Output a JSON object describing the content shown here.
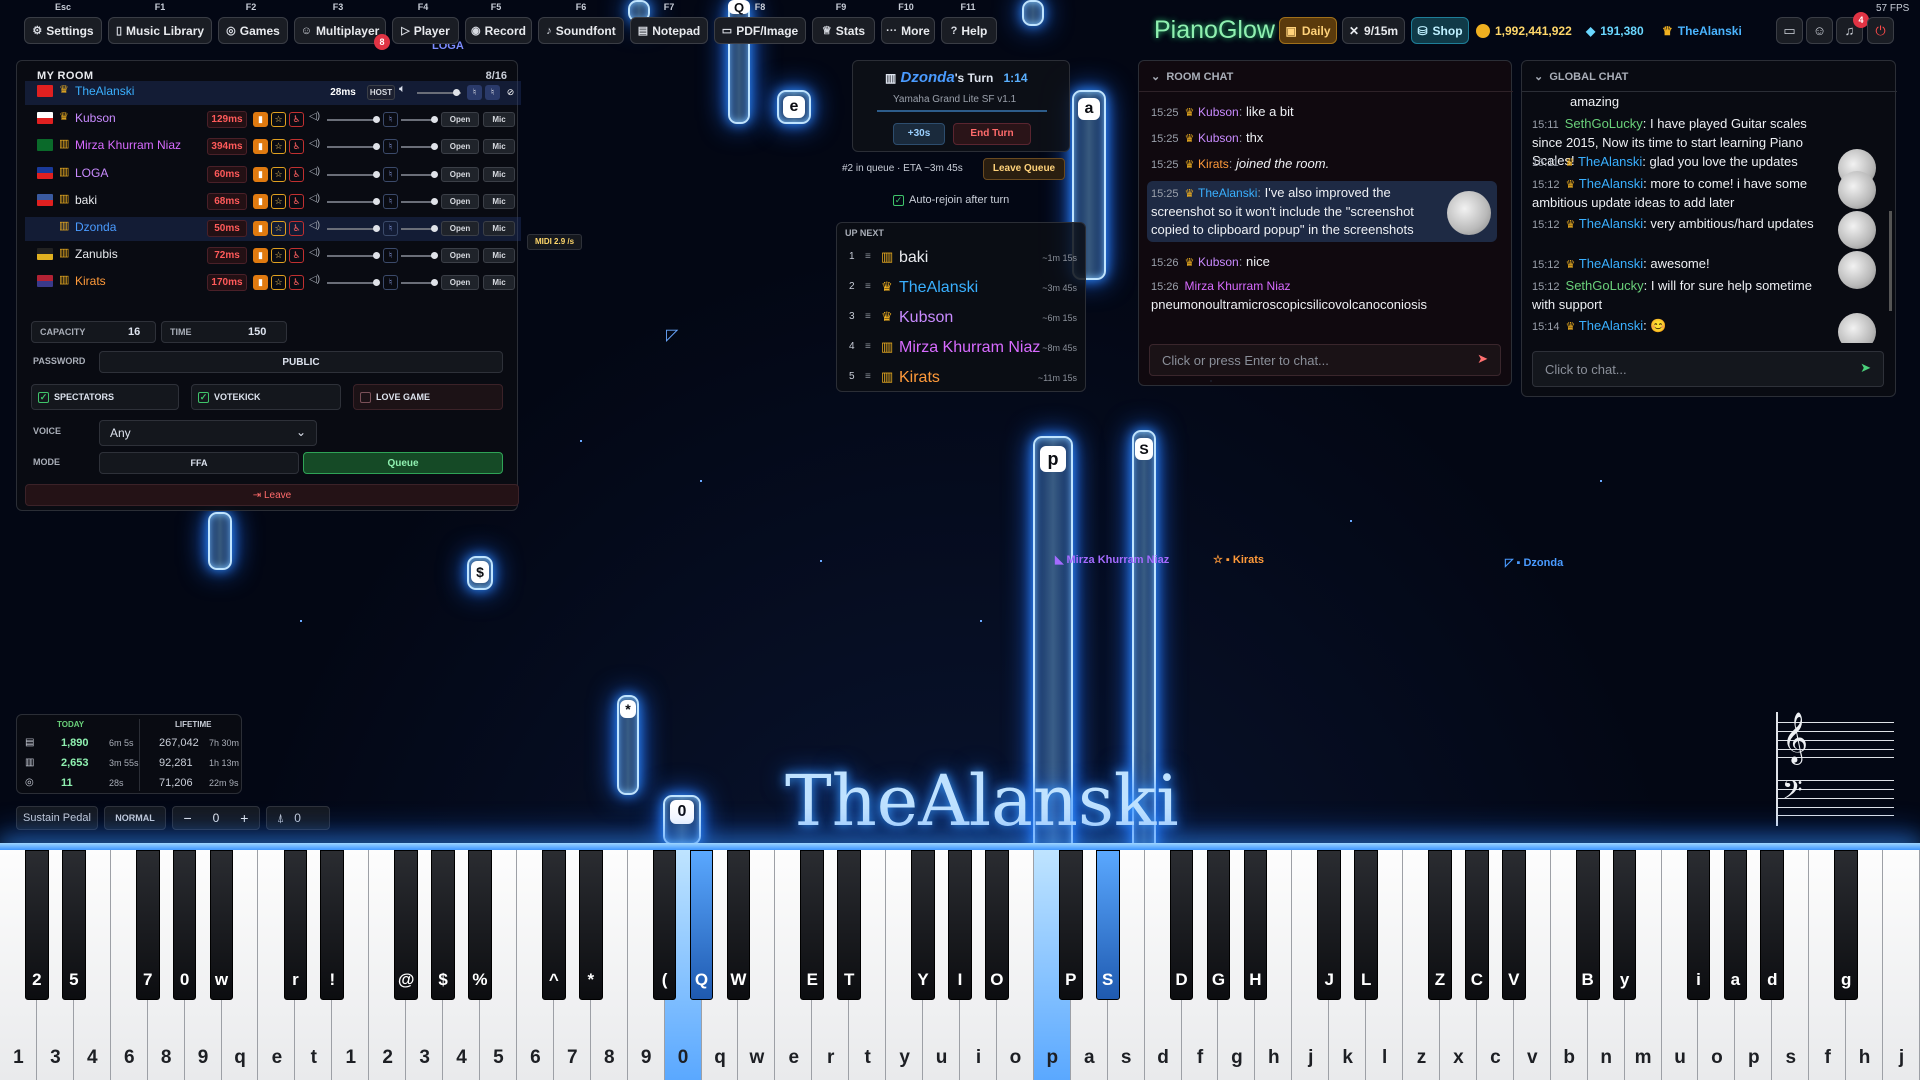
{
  "topbar": {
    "fkeys": [
      "Esc",
      "F1",
      "F2",
      "F3",
      "F4",
      "F5",
      "F6",
      "F7",
      "F8",
      "F9",
      "F10",
      "F11"
    ],
    "buttons": [
      "Settings",
      "Music Library",
      "Games",
      "Multiplayer",
      "Player",
      "Record",
      "Soundfont",
      "Notepad",
      "PDF/Image",
      "Stats",
      "More",
      "Help"
    ],
    "multiplayer_badge": "8",
    "brand": "PianoGlow",
    "daily": "Daily",
    "rate": "9/15m",
    "shop": "Shop",
    "coins": "1,992,441,922",
    "gems": "191,380",
    "username": "TheAlanski",
    "notif_count": "4",
    "fps": "57 FPS"
  },
  "room": {
    "title": "MY ROOM",
    "count": "8/16",
    "players": [
      {
        "name": "TheAlanski",
        "ping": "28ms",
        "host": "HOST",
        "crown": true,
        "color": "#3ab0ff"
      },
      {
        "name": "Kubson",
        "ping": "129ms",
        "crown": true,
        "color": "#c98bff"
      },
      {
        "name": "Mirza Khurram Niaz",
        "ping": "394ms",
        "crown": false,
        "color": "#d86bff"
      },
      {
        "name": "LOGA",
        "ping": "60ms",
        "crown": false,
        "color": "#c98bff"
      },
      {
        "name": "baki",
        "ping": "68ms",
        "crown": false,
        "color": "#e8eaee"
      },
      {
        "name": "Dzonda",
        "ping": "50ms",
        "crown": false,
        "color": "#4a9bff"
      },
      {
        "name": "Zanubis",
        "ping": "72ms",
        "crown": false,
        "color": "#e8eaee"
      },
      {
        "name": "Kirats",
        "ping": "170ms",
        "crown": false,
        "color": "#ff9a3a"
      }
    ],
    "open": "Open",
    "mic": "Mic",
    "capacity_label": "CAPACITY",
    "capacity": "16",
    "time_label": "TIME",
    "time": "150",
    "password_label": "PASSWORD",
    "password": "PUBLIC",
    "spectators": "SPECTATORS",
    "votekick": "VOTEKICK",
    "love": "LOVE GAME",
    "voice_label": "VOICE",
    "voice": "Any",
    "mode_label": "MODE",
    "mode_ffa": "FFA",
    "mode_queue": "Queue",
    "leave": "Leave",
    "midi": "MIDI 2.9 /s"
  },
  "turn": {
    "player": "Dzonda",
    "suffix": "'s Turn",
    "timer": "1:14",
    "instrument": "Yamaha Grand Lite SF v1.1",
    "plus": "+30s",
    "end": "End Turn",
    "queue_info": "#2 in queue · ETA ~3m 45s",
    "leave_queue": "Leave Queue",
    "autorejoin": "Auto-rejoin after turn",
    "upnext": "UP NEXT",
    "queue": [
      {
        "n": "1",
        "name": "baki",
        "eta": "~1m 15s",
        "color": "#e8eaee"
      },
      {
        "n": "2",
        "name": "TheAlanski",
        "eta": "~3m 45s",
        "color": "#3ab0ff"
      },
      {
        "n": "3",
        "name": "Kubson",
        "eta": "~6m 15s",
        "color": "#c98bff"
      },
      {
        "n": "4",
        "name": "Mirza Khurram Niaz",
        "eta": "~8m 45s",
        "color": "#d86bff"
      },
      {
        "n": "5",
        "name": "Kirats",
        "eta": "~11m 15s",
        "color": "#ff9a3a"
      }
    ]
  },
  "roomchat": {
    "title": "ROOM CHAT",
    "messages": [
      {
        "t": "15:25",
        "user": "Kubson",
        "text": "like a bit"
      },
      {
        "t": "15:25",
        "user": "Kubson",
        "text": "thx"
      },
      {
        "t": "15:25",
        "user": "Kirats",
        "text": "joined the room."
      },
      {
        "t": "15:25",
        "user": "TheAlanski",
        "text": "I've also improved the screenshot so it won't include the \"screenshot copied to clipboard popup\" in the screenshots"
      },
      {
        "t": "15:26",
        "user": "Kubson",
        "text": "nice"
      },
      {
        "t": "15:26",
        "user": "Mirza Khurram Niaz",
        "text": "pneumonoultramicroscopicsilicovolcanoconiosis"
      }
    ],
    "placeholder": "Click or press Enter to chat..."
  },
  "globalchat": {
    "title": "GLOBAL CHAT",
    "messages": [
      {
        "t": "",
        "user": "",
        "text": "amazing"
      },
      {
        "t": "15:11",
        "user": "SethGoLucky",
        "text": "I have played Guitar scales since 2015, Now its time to start learning Piano Scales!"
      },
      {
        "t": "15:11",
        "user": "TheAlanski",
        "text": "glad you love the updates"
      },
      {
        "t": "15:12",
        "user": "TheAlanski",
        "text": "more to come! i have some ambitious update ideas to add later"
      },
      {
        "t": "15:12",
        "user": "TheAlanski",
        "text": "very ambitious/hard updates"
      },
      {
        "t": "15:12",
        "user": "TheAlanski",
        "text": "awesome!"
      },
      {
        "t": "15:12",
        "user": "SethGoLucky",
        "text": "I will for sure help sometime with support"
      },
      {
        "t": "15:14",
        "user": "TheAlanski",
        "text": "😊"
      }
    ],
    "placeholder": "Click to chat..."
  },
  "stats": {
    "today": "TODAY",
    "lifetime": "LIFETIME",
    "rows": [
      {
        "a": "1,890",
        "b": "6m 5s",
        "c": "267,042",
        "d": "7h 30m"
      },
      {
        "a": "2,653",
        "b": "3m 55s",
        "c": "92,281",
        "d": "1h 13m"
      },
      {
        "a": "11",
        "b": "28s",
        "c": "71,206",
        "d": "22m 9s"
      }
    ]
  },
  "controls": {
    "sustain": "Sustain Pedal",
    "normal": "NORMAL",
    "minus": "−",
    "value": "0",
    "plus": "+",
    "metro": "0"
  },
  "stage": {
    "player_name": "TheAlanski",
    "cursors": [
      {
        "name": "LOGA"
      },
      {
        "name": "Mirza Khurram Niaz"
      },
      {
        "name": "Kirats"
      },
      {
        "name": "Dzonda"
      }
    ]
  },
  "notes": {
    "letters": [
      "Q",
      "e",
      "a",
      "$",
      "*",
      "0",
      "p",
      "S"
    ]
  },
  "piano": {
    "white_labels": [
      "1",
      "3",
      "4",
      "6",
      "8",
      "9",
      "q",
      "e",
      "t",
      "1",
      "2",
      "3",
      "4",
      "5",
      "6",
      "7",
      "8",
      "9",
      "0",
      "q",
      "w",
      "e",
      "r",
      "t",
      "y",
      "u",
      "i",
      "o",
      "p",
      "a",
      "s",
      "d",
      "f",
      "g",
      "h",
      "j",
      "k",
      "l",
      "z",
      "x",
      "c",
      "v",
      "b",
      "n",
      "m",
      "u",
      "o",
      "p",
      "s",
      "f",
      "h",
      "j"
    ],
    "black_labels": [
      "2",
      "5",
      "7",
      "0",
      "w",
      "r",
      "!",
      "@",
      "$",
      "%",
      "^",
      "*",
      "(",
      "Q",
      "W",
      "E",
      "T",
      "Y",
      "I",
      "O",
      "P",
      "S",
      "D",
      "G",
      "H",
      "J",
      "L",
      "Z",
      "C",
      "V",
      "B",
      "y",
      "i",
      "a",
      "d",
      "g"
    ]
  }
}
